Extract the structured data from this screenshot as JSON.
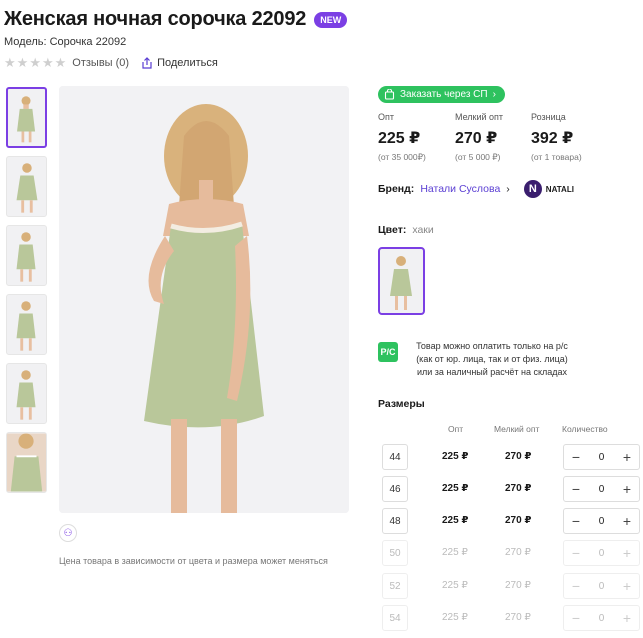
{
  "product": {
    "title": "Женская ночная сорочка 22092",
    "badge": "NEW",
    "model": "Модель: Сорочка 22092",
    "reviews": "Отзывы (0)",
    "share": "Поделиться"
  },
  "order_button": "Заказать через СП",
  "prices": [
    {
      "label": "Опт",
      "value": "225 ₽",
      "sub": "(от 35 000₽)"
    },
    {
      "label": "Мелкий опт",
      "value": "270 ₽",
      "sub": "(от 5 000 ₽)"
    },
    {
      "label": "Розница",
      "value": "392 ₽",
      "sub": "(от 1 товара)"
    }
  ],
  "brand": {
    "label": "Бренд:",
    "name": "Натали Суслова",
    "logo_text": "NATALI"
  },
  "color": {
    "label": "Цвет:",
    "value": "хаки"
  },
  "payment_note": "Товар можно оплатить только на р/с (как от юр. лица, так и от физ. лица) или за наличный расчёт на складах",
  "sizes": {
    "title": "Размеры",
    "headers": {
      "opt": "Опт",
      "small": "Мелкий опт",
      "qty": "Количество"
    },
    "rows": [
      {
        "size": "44",
        "opt": "225 ₽",
        "small": "270 ₽",
        "qty": "0",
        "available": true
      },
      {
        "size": "46",
        "opt": "225 ₽",
        "small": "270 ₽",
        "qty": "0",
        "available": true
      },
      {
        "size": "48",
        "opt": "225 ₽",
        "small": "270 ₽",
        "qty": "0",
        "available": true
      },
      {
        "size": "50",
        "opt": "225 ₽",
        "small": "270 ₽",
        "qty": "0",
        "available": false
      },
      {
        "size": "52",
        "opt": "225 ₽",
        "small": "270 ₽",
        "qty": "0",
        "available": false
      },
      {
        "size": "54",
        "opt": "225 ₽",
        "small": "270 ₽",
        "qty": "0",
        "available": false
      }
    ]
  },
  "price_note": "Цена товара в зависимости от цвета и размера может меняться",
  "colors": {
    "accent": "#7b3fe4",
    "green": "#2ec25f",
    "dress": "#b9c79a"
  }
}
